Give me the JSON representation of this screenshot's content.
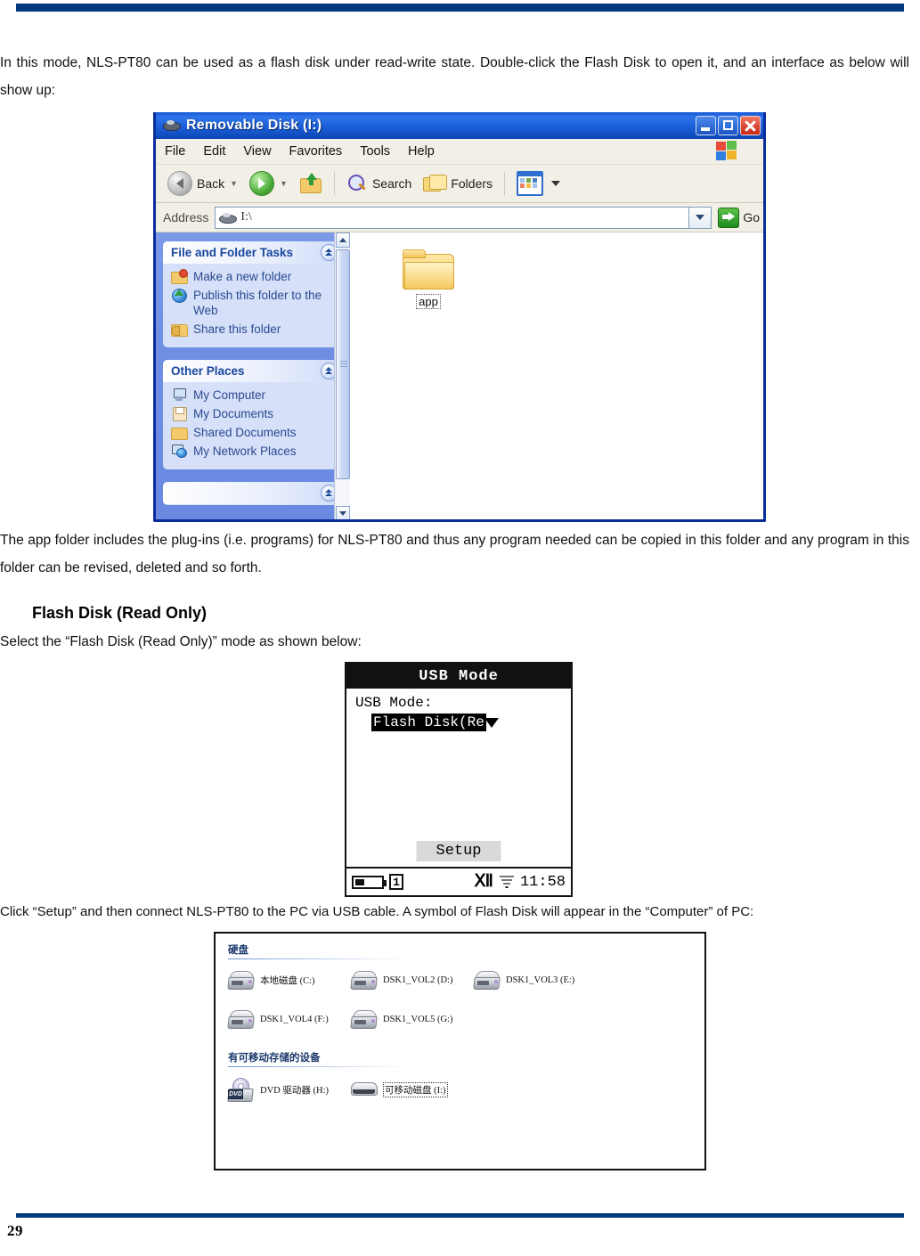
{
  "document": {
    "page_number": "29",
    "paragraph_1": "In this mode, NLS-PT80 can be used as a flash disk under read-write state. Double-click the Flash Disk to open it, and an interface as below will show up:",
    "paragraph_2": "The app folder includes the plug-ins (i.e. programs) for NLS-PT80 and thus any program needed can be copied in this folder and any program in this folder can be revised, deleted and so forth.",
    "heading_flash_disk_read_only": "Flash Disk (Read Only)",
    "paragraph_3": "Select the “Flash Disk (Read Only)” mode as shown below:",
    "paragraph_4": "Click “Setup” and then connect NLS-PT80 to the PC via USB cable. A symbol of Flash Disk will appear in the “Computer” of PC:",
    "rule_color": "#003A7D"
  },
  "explorer": {
    "title": "Removable Disk (I:)",
    "menu": [
      "File",
      "Edit",
      "View",
      "Favorites",
      "Tools",
      "Help"
    ],
    "toolbar": {
      "back": "Back",
      "search": "Search",
      "folders": "Folders"
    },
    "address": {
      "label": "Address",
      "value": "I:\\",
      "go": "Go"
    },
    "panels": [
      {
        "title": "File and Folder Tasks",
        "items": [
          "Make a new folder",
          "Publish this folder to the Web",
          "Share this folder"
        ]
      },
      {
        "title": "Other Places",
        "items": [
          "My Computer",
          "My Documents",
          "Shared Documents",
          "My Network Places"
        ]
      }
    ],
    "files": [
      {
        "name": "app",
        "type": "folder",
        "selected": true
      }
    ]
  },
  "device_screen": {
    "title": "USB Mode",
    "field_label": "USB Mode:",
    "field_value": "Flash Disk(Re",
    "softkey": "Setup",
    "status": {
      "battery_slot": "1",
      "time": "11:58"
    }
  },
  "computer_window": {
    "groups": [
      {
        "title": "硬盘",
        "items": [
          {
            "label": "本地磁盘 (C:)",
            "icon": "hard-disk-icon",
            "selected": false
          },
          {
            "label": "DSK1_VOL2 (D:)",
            "icon": "hard-disk-icon",
            "selected": false
          },
          {
            "label": "DSK1_VOL3 (E:)",
            "icon": "hard-disk-icon",
            "selected": false
          },
          {
            "label": "DSK1_VOL4 (F:)",
            "icon": "hard-disk-icon",
            "selected": false
          },
          {
            "label": "DSK1_VOL5 (G:)",
            "icon": "hard-disk-icon",
            "selected": false
          }
        ]
      },
      {
        "title": "有可移动存储的设备",
        "items": [
          {
            "label": "DVD 驱动器 (H:)",
            "icon": "dvd-drive-icon",
            "selected": false
          },
          {
            "label": "可移动磁盘 (I:)",
            "icon": "removable-disk-icon",
            "selected": true
          }
        ]
      }
    ],
    "dvd_badge": "DVD"
  }
}
